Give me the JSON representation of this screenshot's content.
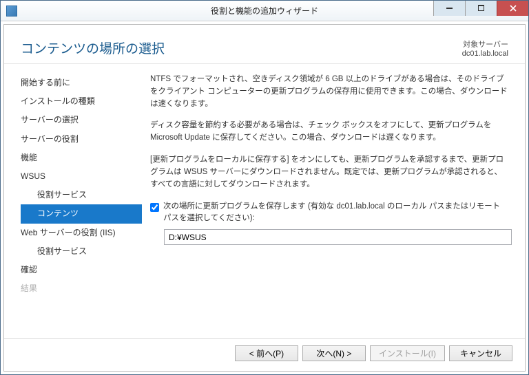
{
  "titlebar": {
    "title": "役割と機能の追加ウィザード"
  },
  "header": {
    "page_title": "コンテンツの場所の選択",
    "target_label": "対象サーバー",
    "target_value": "dc01.lab.local"
  },
  "sidebar": {
    "items": [
      {
        "label": "開始する前に",
        "indent": false,
        "selected": false,
        "disabled": false
      },
      {
        "label": "インストールの種類",
        "indent": false,
        "selected": false,
        "disabled": false
      },
      {
        "label": "サーバーの選択",
        "indent": false,
        "selected": false,
        "disabled": false
      },
      {
        "label": "サーバーの役割",
        "indent": false,
        "selected": false,
        "disabled": false
      },
      {
        "label": "機能",
        "indent": false,
        "selected": false,
        "disabled": false
      },
      {
        "label": "WSUS",
        "indent": false,
        "selected": false,
        "disabled": false
      },
      {
        "label": "役割サービス",
        "indent": true,
        "selected": false,
        "disabled": false
      },
      {
        "label": "コンテンツ",
        "indent": true,
        "selected": true,
        "disabled": false
      },
      {
        "label": "Web サーバーの役割 (IIS)",
        "indent": false,
        "selected": false,
        "disabled": false
      },
      {
        "label": "役割サービス",
        "indent": true,
        "selected": false,
        "disabled": false
      },
      {
        "label": "確認",
        "indent": false,
        "selected": false,
        "disabled": false
      },
      {
        "label": "結果",
        "indent": false,
        "selected": false,
        "disabled": true
      }
    ]
  },
  "main": {
    "para1": "NTFS でフォーマットされ、空きディスク領域が 6 GB 以上のドライブがある場合は、そのドライブをクライアント コンピューターの更新プログラムの保存用に使用できます。この場合、ダウンロードは速くなります。",
    "para2": "ディスク容量を節約する必要がある場合は、チェック ボックスをオフにして、更新プログラムを Microsoft Update に保存してください。この場合、ダウンロードは遅くなります。",
    "para3": "[更新プログラムをローカルに保存する] をオンにしても、更新プログラムを承認するまで、更新プログラムは WSUS サーバーにダウンロードされません。既定では、更新プログラムが承認されると、すべての言語に対してダウンロードされます。",
    "checkbox_label": "次の場所に更新プログラムを保存します (有効な dc01.lab.local のローカル パスまたはリモート パスを選択してください):",
    "checkbox_checked": true,
    "path_value": "D:¥WSUS"
  },
  "buttons": {
    "previous": "< 前へ(P)",
    "next": "次へ(N) >",
    "install": "インストール(I)",
    "cancel": "キャンセル"
  }
}
